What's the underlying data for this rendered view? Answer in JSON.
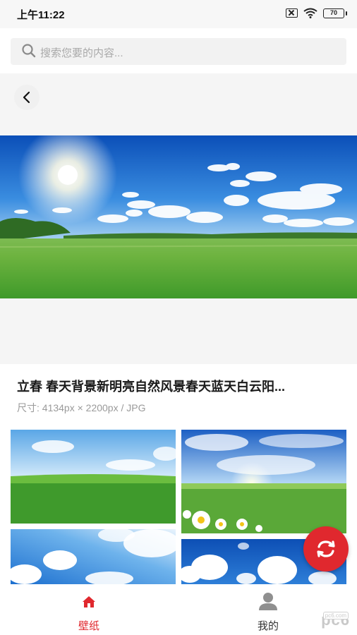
{
  "status_bar": {
    "time": "上午11:22",
    "battery": "70",
    "icons": [
      "no-sim-icon",
      "wifi-icon",
      "battery-icon"
    ]
  },
  "search": {
    "placeholder": "搜索您要的内容..."
  },
  "preview": {
    "back_icon": "chevron-left-icon",
    "title": "立春 春天背景新明亮自然风景春天蓝天白云阳...",
    "meta": "尺寸: 4134px × 2200px / JPG"
  },
  "grid": {
    "items": [
      {
        "subject": "green-field-blue-sky"
      },
      {
        "subject": "daisy-meadow-sunlight"
      },
      {
        "subject": "sun-through-clouds"
      },
      {
        "subject": "white-clouds-blue-sky"
      }
    ]
  },
  "fab": {
    "icon": "refresh-arrows-icon"
  },
  "bottom_nav": {
    "items": [
      {
        "label": "壁纸",
        "icon": "home-icon",
        "active": true
      },
      {
        "label": "我的",
        "icon": "person-icon",
        "active": false
      }
    ],
    "watermark": "pc6",
    "watermark_sub": "pc6.com"
  },
  "colors": {
    "accent": "#e0282e",
    "sky": "#1f6fd6",
    "grass": "#4caf3a",
    "text_secondary": "#9a9a9a"
  }
}
